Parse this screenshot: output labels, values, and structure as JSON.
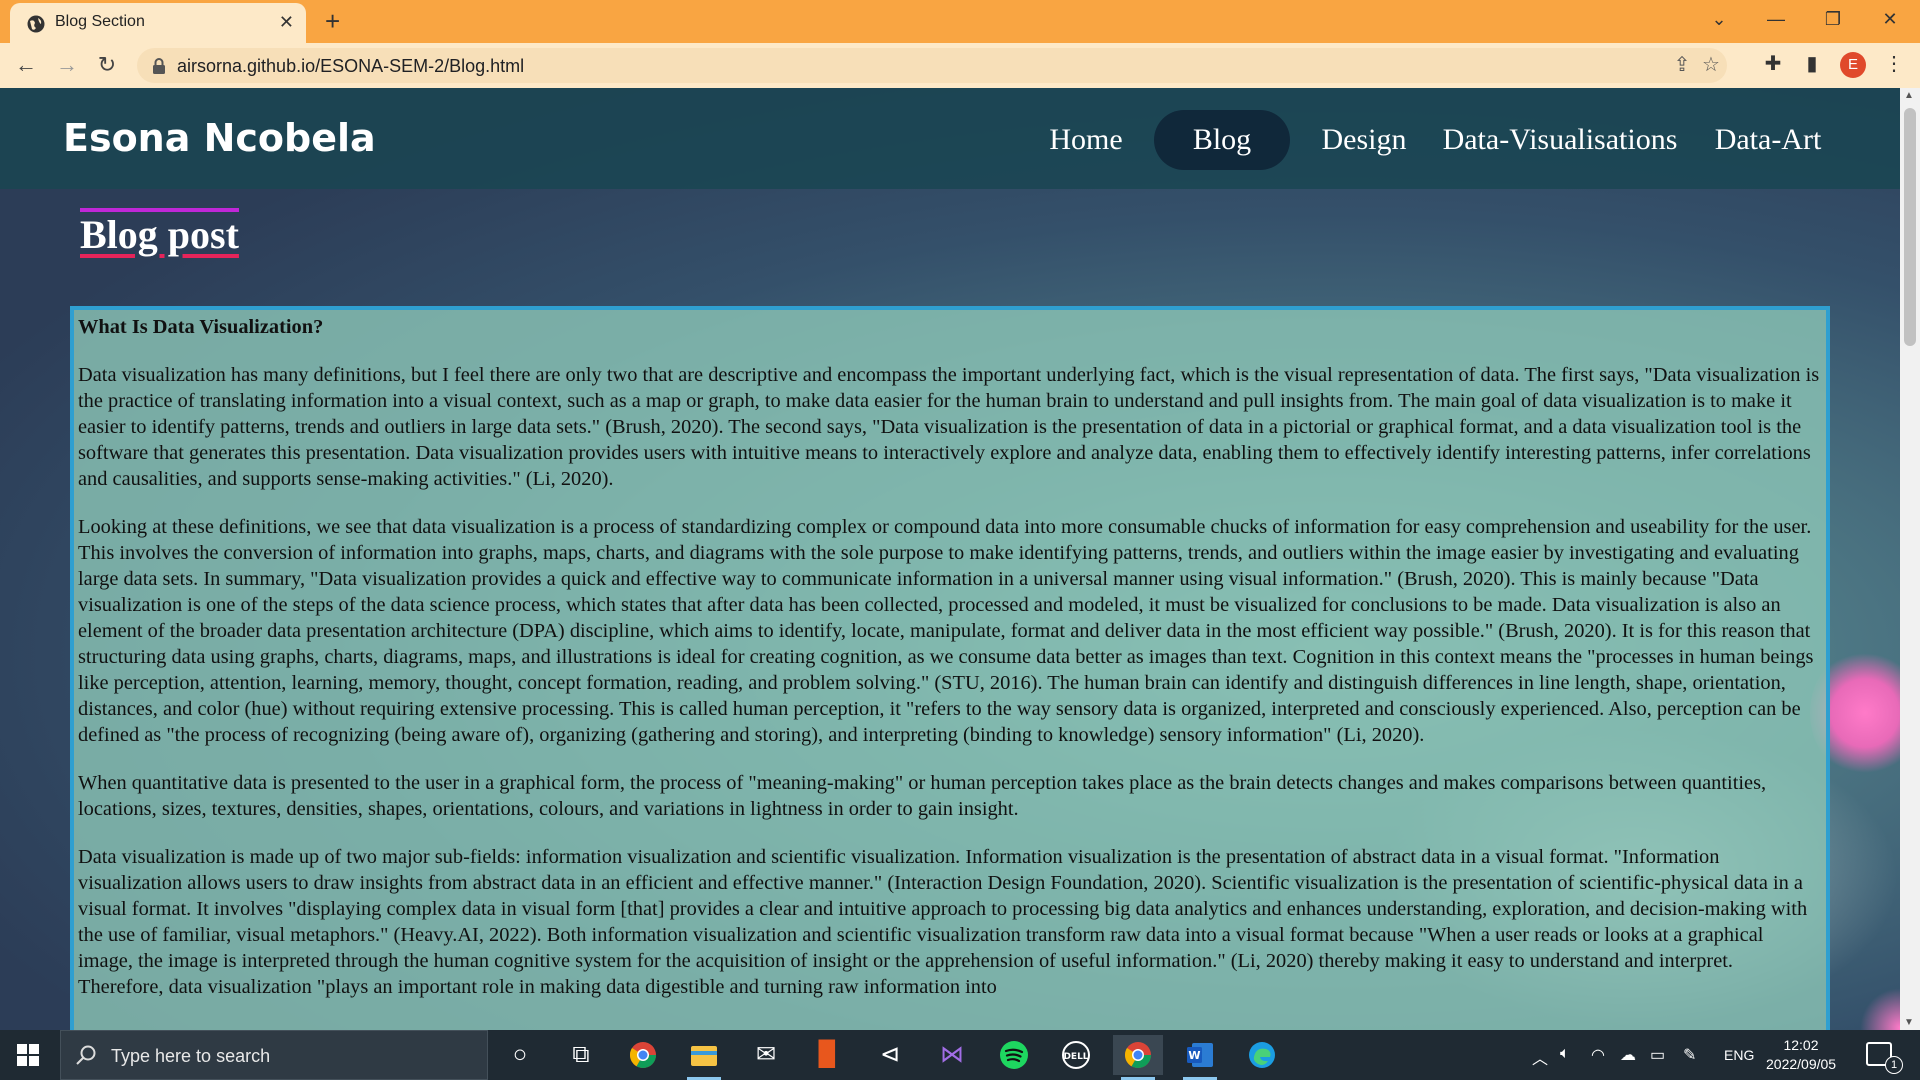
{
  "browser": {
    "tab_title": "Blog Section",
    "url": "airsorna.github.io/ESONA-SEM-2/Blog.html",
    "profile_initial": "E",
    "window_controls": [
      "⌄",
      "—",
      "❐",
      "✕"
    ]
  },
  "site": {
    "name": "Esona Ncobela",
    "nav": [
      {
        "label": "Home",
        "active": false
      },
      {
        "label": "Blog",
        "active": true
      },
      {
        "label": "Design",
        "active": false
      },
      {
        "label": "Data-Visualisations",
        "active": false
      },
      {
        "label": "Data-Art",
        "active": false
      }
    ],
    "section_title": "Blog post"
  },
  "post": {
    "heading": "What Is Data Visualization?",
    "paragraphs": [
      "Data visualization has many definitions, but I feel there are only two that are descriptive and encompass the important underlying fact, which is the visual representation of data. The first says, \"Data visualization is the practice of translating information into a visual context, such as a map or graph, to make data easier for the human brain to understand and pull insights from. The main goal of data visualization is to make it easier to identify patterns, trends and outliers in large data sets.\" (Brush, 2020). The second says, \"Data visualization is the presentation of data in a pictorial or graphical format, and a data visualization tool is the software that generates this presentation. Data visualization provides users with intuitive means to interactively explore and analyze data, enabling them to effectively identify interesting patterns, infer correlations and causalities, and supports sense-making activities.\" (Li, 2020).",
      "Looking at these definitions, we see that data visualization is a process of standardizing complex or compound data into more consumable chucks of information for easy comprehension and useability for the user. This involves the conversion of information into graphs, maps, charts, and diagrams with the sole purpose to make identifying patterns, trends, and outliers within the image easier by investigating and evaluating large data sets. In summary, \"Data visualization provides a quick and effective way to communicate information in a universal manner using visual information.\" (Brush, 2020). This is mainly because \"Data visualization is one of the steps of the data science process, which states that after data has been collected, processed and modeled, it must be visualized for conclusions to be made. Data visualization is also an element of the broader data presentation architecture (DPA) discipline, which aims to identify, locate, manipulate, format and deliver data in the most efficient way possible.\" (Brush, 2020). It is for this reason that structuring data using graphs, charts, diagrams, maps, and illustrations is ideal for creating cognition, as we consume data better as images than text. Cognition in this context means the \"processes in human beings like perception, attention, learning, memory, thought, concept formation, reading, and problem solving.\" (STU, 2016). The human brain can identify and distinguish differences in line length, shape, orientation, distances, and color (hue) without requiring extensive processing. This is called human perception, it \"refers to the way sensory data is organized, interpreted and consciously experienced. Also, perception can be defined as \"the process of recognizing (being aware of), organizing (gathering and storing), and interpreting (binding to knowledge) sensory information\" (Li, 2020).",
      "When quantitative data is presented to the user in a graphical form, the process of \"meaning-making\" or human perception takes place as the brain detects changes and makes comparisons between quantities, locations, sizes, textures, densities, shapes, orientations, colours, and variations in lightness in order to gain insight.",
      "Data visualization is made up of two major sub-fields: information visualization and scientific visualization. Information visualization is the presentation of abstract data in a visual format. \"Information visualization allows users to draw insights from abstract data in an efficient and effective manner.\" (Interaction Design Foundation, 2020). Scientific visualization is the presentation of scientific-physical data in a visual format. It involves \"displaying complex data in visual form [that] provides a clear and intuitive approach to processing big data analytics and enhances understanding, exploration, and decision-making with the use of familiar, visual metaphors.\" (Heavy.AI, 2022). Both information visualization and scientific visualization transform raw data into a visual format because \"When a user reads or looks at a graphical image, the image is interpreted through the human cognitive system for the acquisition of insight or the apprehension of useful information.\" (Li, 2020) thereby making it easy to understand and interpret. Therefore, data visualization \"plays an important role in making data digestible and turning raw information into"
    ]
  },
  "taskbar": {
    "search_placeholder": "Type here to search",
    "language": "ENG",
    "time": "12:02",
    "date": "2022/09/05",
    "notification_count": "1"
  }
}
